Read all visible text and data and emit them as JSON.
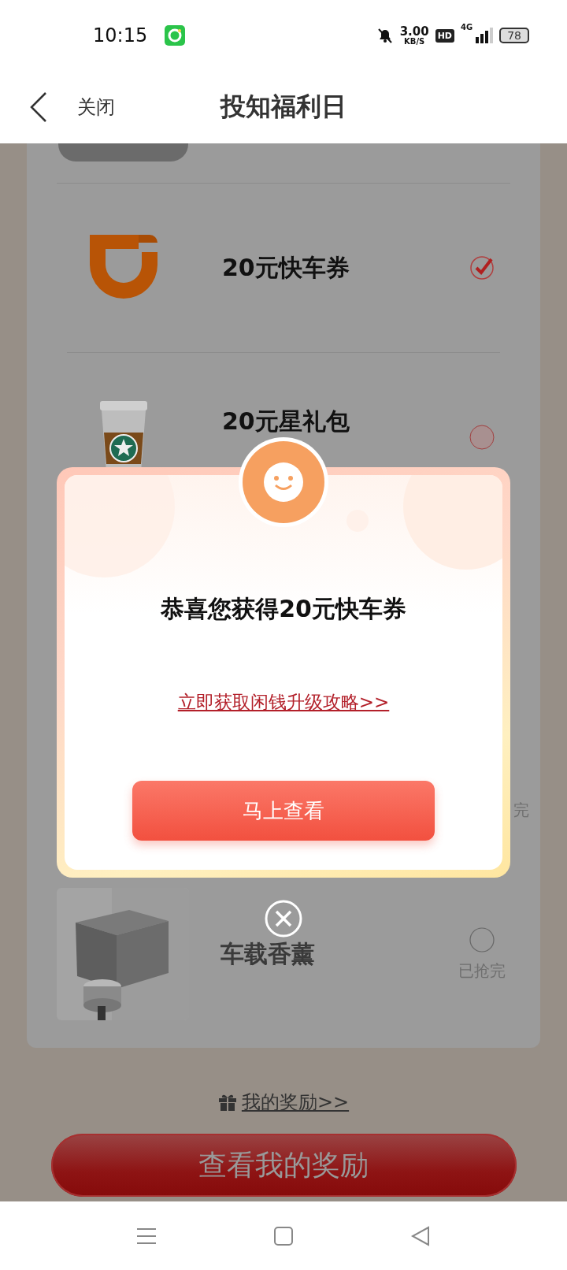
{
  "status_bar": {
    "time": "10:15",
    "net_speed": "3.00",
    "net_unit": "KB/S",
    "hd": "HD",
    "network": "4G",
    "battery": "78"
  },
  "header": {
    "back_label": "关闭",
    "title": "投知福利日"
  },
  "prizes": [
    {
      "kind": "cut"
    },
    {
      "kind": "ride",
      "name": "20元快车券",
      "selected": true
    },
    {
      "kind": "coffee",
      "name": "20元星礼包",
      "selected": false
    },
    {
      "kind": "covered",
      "status": "完"
    },
    {
      "kind": "gift",
      "name": "车载香薰",
      "selected": false,
      "status": "已抢完"
    }
  ],
  "footer": {
    "rewards_link": "我的奖励>>",
    "main_button": "查看我的奖励"
  },
  "popup": {
    "title": "恭喜您获得20元快车券",
    "link": "立即获取闲钱升级攻略>>",
    "button": "马上查看"
  }
}
